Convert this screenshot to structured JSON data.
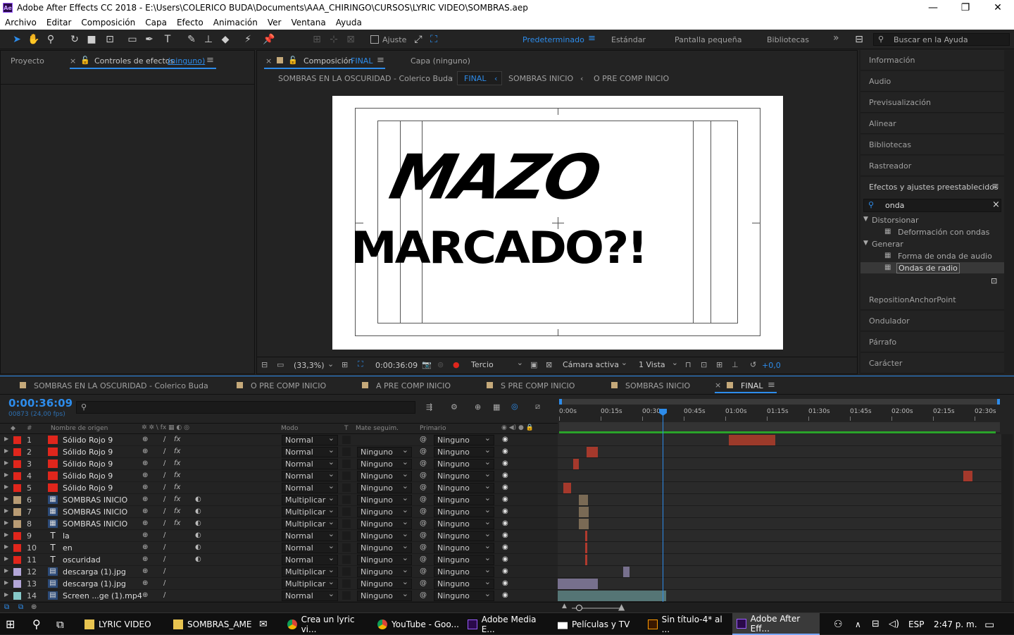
{
  "window": {
    "title": "Adobe After Effects CC 2018 - E:\\Users\\COLERICO BUDA\\Documents\\AAA_CHIRINGO\\CURSOS\\LYRIC VIDEO\\SOMBRAS.aep",
    "app_badge": "Ae",
    "minimize": "—",
    "maximize": "❐",
    "close": "✕"
  },
  "menu": [
    "Archivo",
    "Editar",
    "Composición",
    "Capa",
    "Efecto",
    "Animación",
    "Ver",
    "Ventana",
    "Ayuda"
  ],
  "toolbar": {
    "snap_label": "Ajuste",
    "workspaces": [
      "Predeterminado",
      "Estándar",
      "Pantalla pequeña",
      "Bibliotecas"
    ],
    "more": "»",
    "search_placeholder": "Buscar en la Ayuda"
  },
  "left_panel": {
    "tab_project": "Proyecto",
    "tab_effects": "Controles de efectos",
    "tab_effects_target": "(ninguno)"
  },
  "comp_panel": {
    "tab_label": "Composición",
    "tab_comp": "FINAL",
    "tab_layer": "Capa  (ninguno)",
    "breadcrumbs": [
      "SOMBRAS EN LA OSCURIDAD  - Colerico Buda",
      "FINAL",
      "SOMBRAS INICIO",
      "O PRE COMP INICIO"
    ],
    "line1": "MAZO",
    "line2": "MARCADO?!",
    "zoom": "(33,3%)",
    "timecode": "0:00:36:09",
    "grid": "Tercio",
    "camera": "Cámara activa",
    "views": "1 Vista",
    "exposure": "+0,0"
  },
  "right_panel": {
    "items_top": [
      "Información",
      "Audio",
      "Previsualización",
      "Alinear",
      "Bibliotecas",
      "Rastreador"
    ],
    "effects_title": "Efectos y ajustes preestablecidos",
    "search_value": "onda",
    "tree": [
      {
        "group": "Distorsionar",
        "items": [
          "Deformación con ondas"
        ]
      },
      {
        "group": "Generar",
        "items": [
          "Forma de onda de audio",
          "Ondas de radio"
        ]
      }
    ],
    "items_bottom": [
      "RepositionAnchorPoint",
      "Ondulador",
      "Párrafo",
      "Carácter"
    ]
  },
  "timeline": {
    "tabs": [
      "SOMBRAS EN LA OSCURIDAD  - Colerico Buda",
      "O PRE COMP INICIO",
      "A PRE COMP INICIO",
      "S PRE COMP INICIO",
      "SOMBRAS INICIO",
      "FINAL"
    ],
    "timecode": "0:00:36:09",
    "fps": "00873 (24,00 fps)",
    "columns": {
      "num": "#",
      "name": "Nombre de origen",
      "mode": "Modo",
      "t": "T",
      "matte": "Mate seguim.",
      "parent": "Primario"
    },
    "ruler": [
      "0:00s",
      "00:15s",
      "00:30s",
      "00:45s",
      "01:00s",
      "01:15s",
      "01:30s",
      "01:45s",
      "02:00s",
      "02:15s",
      "02:30s"
    ],
    "layers": [
      {
        "n": "1",
        "name": "Sólido Rojo 9",
        "type": "solid",
        "color": "#e0261c",
        "mode": "Normal",
        "matte": "",
        "parent": "Ninguno",
        "bar": {
          "start": 0.385,
          "end": 0.49,
          "color": "#9c3a2a"
        }
      },
      {
        "n": "2",
        "name": "Sólido Rojo 9",
        "type": "solid",
        "color": "#e0261c",
        "mode": "Normal",
        "matte": "Ninguno",
        "parent": "Ninguno",
        "bar": {
          "start": 0.065,
          "end": 0.09,
          "color": "#a5392c"
        }
      },
      {
        "n": "3",
        "name": "Sólido Rojo 9",
        "type": "solid",
        "color": "#e0261c",
        "mode": "Normal",
        "matte": "Ninguno",
        "parent": "Ninguno",
        "bar": {
          "start": 0.035,
          "end": 0.048,
          "color": "#a5392c"
        }
      },
      {
        "n": "4",
        "name": "Sólido Rojo 9",
        "type": "solid",
        "color": "#e0261c",
        "mode": "Normal",
        "matte": "Ninguno",
        "parent": "Ninguno",
        "bar": {
          "start": 0.915,
          "end": 0.935,
          "color": "#a5392c"
        }
      },
      {
        "n": "5",
        "name": "Sólido Rojo 9",
        "type": "solid",
        "color": "#e0261c",
        "mode": "Normal",
        "matte": "Ninguno",
        "parent": "Ninguno",
        "bar": {
          "start": 0.012,
          "end": 0.03,
          "color": "#a5392c"
        }
      },
      {
        "n": "6",
        "name": "SOMBRAS INICIO",
        "type": "comp",
        "color": "#b89b74",
        "mode": "Multiplicar",
        "matte": "Ninguno",
        "parent": "Ninguno",
        "bar": {
          "start": 0.048,
          "end": 0.068,
          "color": "#7a6a55"
        }
      },
      {
        "n": "7",
        "name": "SOMBRAS INICIO",
        "type": "comp",
        "color": "#b89b74",
        "mode": "Multiplicar",
        "matte": "Ninguno",
        "parent": "Ninguno",
        "bar": {
          "start": 0.048,
          "end": 0.07,
          "color": "#7a6a55"
        }
      },
      {
        "n": "8",
        "name": "SOMBRAS INICIO",
        "type": "comp",
        "color": "#b89b74",
        "mode": "Multiplicar",
        "matte": "Ninguno",
        "parent": "Ninguno",
        "bar": {
          "start": 0.048,
          "end": 0.07,
          "color": "#7a6a55"
        }
      },
      {
        "n": "9",
        "name": "la",
        "type": "text",
        "color": "#e0261c",
        "mode": "Normal",
        "matte": "Ninguno",
        "parent": "Ninguno",
        "bar": {
          "start": 0.062,
          "end": 0.065,
          "color": "#b03a2e"
        }
      },
      {
        "n": "10",
        "name": "en",
        "type": "text",
        "color": "#e0261c",
        "mode": "Normal",
        "matte": "Ninguno",
        "parent": "Ninguno",
        "bar": {
          "start": 0.062,
          "end": 0.065,
          "color": "#b03a2e"
        }
      },
      {
        "n": "11",
        "name": "oscuridad",
        "type": "text",
        "color": "#e0261c",
        "mode": "Normal",
        "matte": "Ninguno",
        "parent": "Ninguno",
        "bar": {
          "start": 0.062,
          "end": 0.065,
          "color": "#b03a2e"
        }
      },
      {
        "n": "12",
        "name": "descarga (1).jpg",
        "type": "image",
        "color": "#b3a6d8",
        "mode": "Multiplicar",
        "matte": "Ninguno",
        "parent": "Ninguno",
        "bar": {
          "start": 0.148,
          "end": 0.162,
          "color": "#77708d"
        }
      },
      {
        "n": "13",
        "name": "descarga (1).jpg",
        "type": "image",
        "color": "#b3a6d8",
        "mode": "Multiplicar",
        "matte": "Ninguno",
        "parent": "Ninguno",
        "bar": {
          "start": 0.0,
          "end": 0.09,
          "color": "#77708d"
        }
      },
      {
        "n": "14",
        "name": "Screen ...ge (1).mp4",
        "type": "video",
        "color": "#86c9c9",
        "mode": "Normal",
        "matte": "Ninguno",
        "parent": "Ninguno",
        "bar": {
          "start": 0.0,
          "end": 0.245,
          "color": "#557575"
        }
      }
    ]
  },
  "taskbar": {
    "items": [
      "LYRIC VIDEO",
      "SOMBRAS_AME",
      "",
      "Crea un lyric vi...",
      "YouTube - Goo...",
      "Adobe Media E...",
      "Películas y TV",
      "Sin título-4* al ...",
      "Adobe After Eff..."
    ],
    "lang": "ESP",
    "time": "2:47 p. m."
  }
}
